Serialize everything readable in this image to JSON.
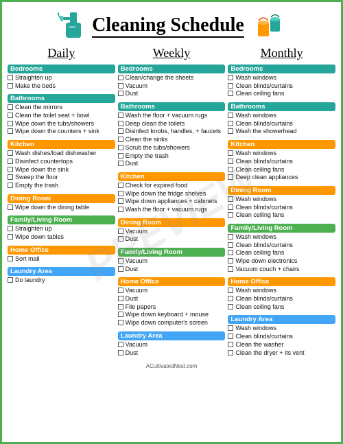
{
  "header": {
    "title": "Cleaning Schedule",
    "footer": "ACultivatedNest.com"
  },
  "watermark": "PREVIEW",
  "columns": [
    {
      "title": "Daily",
      "sections": [
        {
          "name": "Bedrooms",
          "color": "bg-teal",
          "tasks": [
            "Straighten up",
            "Make the beds"
          ]
        },
        {
          "name": "Bathrooms",
          "color": "bg-teal",
          "tasks": [
            "Clean the mirrors",
            "Clean the toilet seat + bowl",
            "Wipe down the tubs/showers",
            "Wipe down the counters + sink"
          ]
        },
        {
          "name": "Kitchen",
          "color": "bg-orange",
          "tasks": [
            "Wash dishes/load dishwasher",
            "Disinfect countertops",
            "Wipe down the sink",
            "Sweep the floor",
            "Empty the trash"
          ]
        },
        {
          "name": "Dining Room",
          "color": "bg-orange",
          "tasks": [
            "Wipe down the dining table"
          ]
        },
        {
          "name": "Family/Living Room",
          "color": "bg-green",
          "tasks": [
            "Straighten up",
            "Wipe down tables"
          ]
        },
        {
          "name": "Home Office",
          "color": "bg-orange",
          "tasks": [
            "Sort mail"
          ]
        },
        {
          "name": "Laundry Area",
          "color": "bg-blue",
          "tasks": [
            "Do laundry"
          ]
        }
      ]
    },
    {
      "title": "Weekly",
      "sections": [
        {
          "name": "Bedrooms",
          "color": "bg-teal",
          "tasks": [
            "Clean/change the sheets",
            "Vacuum",
            "Dust"
          ]
        },
        {
          "name": "Bathrooms",
          "color": "bg-teal",
          "tasks": [
            "Wash the floor + vacuum rugs",
            "Deep clean the toilets",
            "Disinfect knobs, handles, + faucets",
            "Clean the sinks",
            "Scrub the tubs/showers",
            "Empty the trash",
            "Dust"
          ]
        },
        {
          "name": "Kitchen",
          "color": "bg-orange",
          "tasks": [
            "Check for expired food",
            "Wipe down the fridge shelves",
            "Wipe down appliances + cabinets",
            "Wash the floor + vacuum rugs"
          ]
        },
        {
          "name": "Dining Room",
          "color": "bg-orange",
          "tasks": [
            "Vacuum",
            "Dust"
          ]
        },
        {
          "name": "Family/Living Room",
          "color": "bg-green",
          "tasks": [
            "Vacuum",
            "Dust"
          ]
        },
        {
          "name": "Home Office",
          "color": "bg-orange",
          "tasks": [
            "Vacuum",
            "Dust",
            "File papers",
            "Wipe down keyboard + mouse",
            "Wipe down computer's screen"
          ]
        },
        {
          "name": "Laundry Area",
          "color": "bg-blue",
          "tasks": [
            "Vacuum",
            "Dust"
          ]
        }
      ]
    },
    {
      "title": "Monthly",
      "sections": [
        {
          "name": "Bedrooms",
          "color": "bg-teal",
          "tasks": [
            "Wash windows",
            "Clean blinds/curtains",
            "Clean ceiling fans"
          ]
        },
        {
          "name": "Bathrooms",
          "color": "bg-teal",
          "tasks": [
            "Wash windows",
            "Clean blinds/curtains",
            "Wash the showerhead"
          ]
        },
        {
          "name": "Kitchen",
          "color": "bg-orange",
          "tasks": [
            "Wash windows",
            "Clean blinds/curtains",
            "Clean ceiling fans",
            "Deep clean appliances"
          ]
        },
        {
          "name": "Dining Room",
          "color": "bg-orange",
          "tasks": [
            "Wash windows",
            "Clean blinds/curtains",
            "Clean ceiling fans"
          ]
        },
        {
          "name": "Family/Living Room",
          "color": "bg-green",
          "tasks": [
            "Wash windows",
            "Clean blinds/curtains",
            "Clean ceiling fans",
            "Wipe down electronics",
            "Vacuum couch + chairs"
          ]
        },
        {
          "name": "Home Office",
          "color": "bg-orange",
          "tasks": [
            "Wash windows",
            "Clean blinds/curtains",
            "Clean ceiling fans"
          ]
        },
        {
          "name": "Laundry Area",
          "color": "bg-blue",
          "tasks": [
            "Wash windows",
            "Clean blinds/curtains",
            "Clean the washer",
            "Clean the dryer + its vent"
          ]
        }
      ]
    }
  ]
}
